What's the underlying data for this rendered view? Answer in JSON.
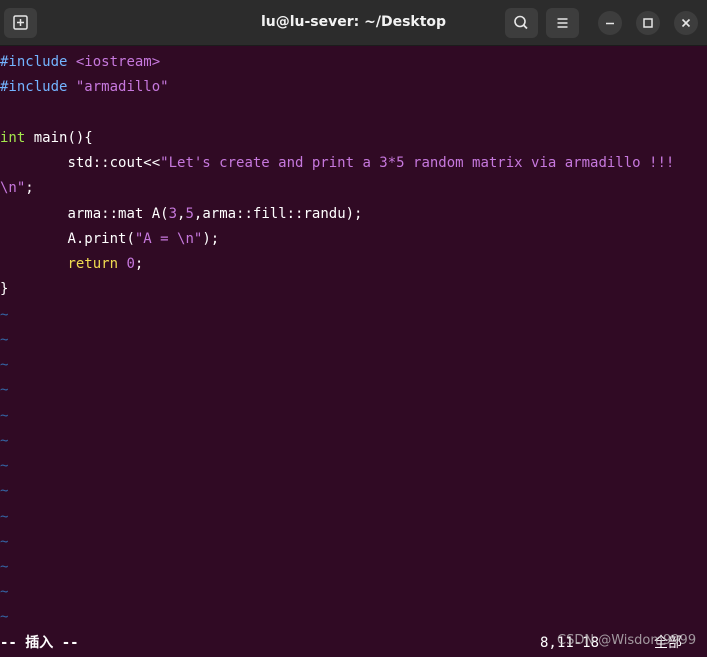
{
  "window": {
    "title": "lu@lu-sever: ~/Desktop"
  },
  "icons": {
    "new_tab": "new-tab-icon",
    "search": "search-icon",
    "menu": "hamburger-menu-icon",
    "minimize": "minimize-icon",
    "maximize": "maximize-icon",
    "close": "close-icon"
  },
  "code": {
    "line1": {
      "kw": "#include",
      "arg": "<iostream>"
    },
    "line2": {
      "kw": "#include",
      "arg": "\"armadillo\""
    },
    "line4": {
      "type": "int",
      "rest": " main(){"
    },
    "line5": {
      "indent": "        ",
      "call": "std::cout<<",
      "str": "\"Let's create and print a 3*5 random matrix via armadillo !!!"
    },
    "line6": {
      "str": "\\n\"",
      "rest": ";"
    },
    "line7": {
      "indent": "        ",
      "a": "arma::mat A(",
      "n1": "3",
      "c1": ",",
      "n2": "5",
      "b": ",arma::fill::randu);"
    },
    "line8": {
      "indent": "        ",
      "a": "A.print(",
      "str": "\"A = \\n\"",
      "b": ");"
    },
    "line9": {
      "indent": "        ",
      "kw": "return",
      "sp": " ",
      "num": "0",
      "b": ";"
    },
    "line10": {
      "text": "}"
    }
  },
  "tilde": "~",
  "status": {
    "mode": "-- 插入 --",
    "position": "8,11-18",
    "scope": "全部"
  },
  "watermark": "CSDN @Wisdom9999",
  "colors": {
    "background": "#300a24",
    "titlebar": "#2c2c2c",
    "preprocessor": "#73b4ff",
    "string": "#c678dd",
    "keyword": "#f0dc50",
    "type": "#a3e64c",
    "tilde": "#3465a4"
  }
}
